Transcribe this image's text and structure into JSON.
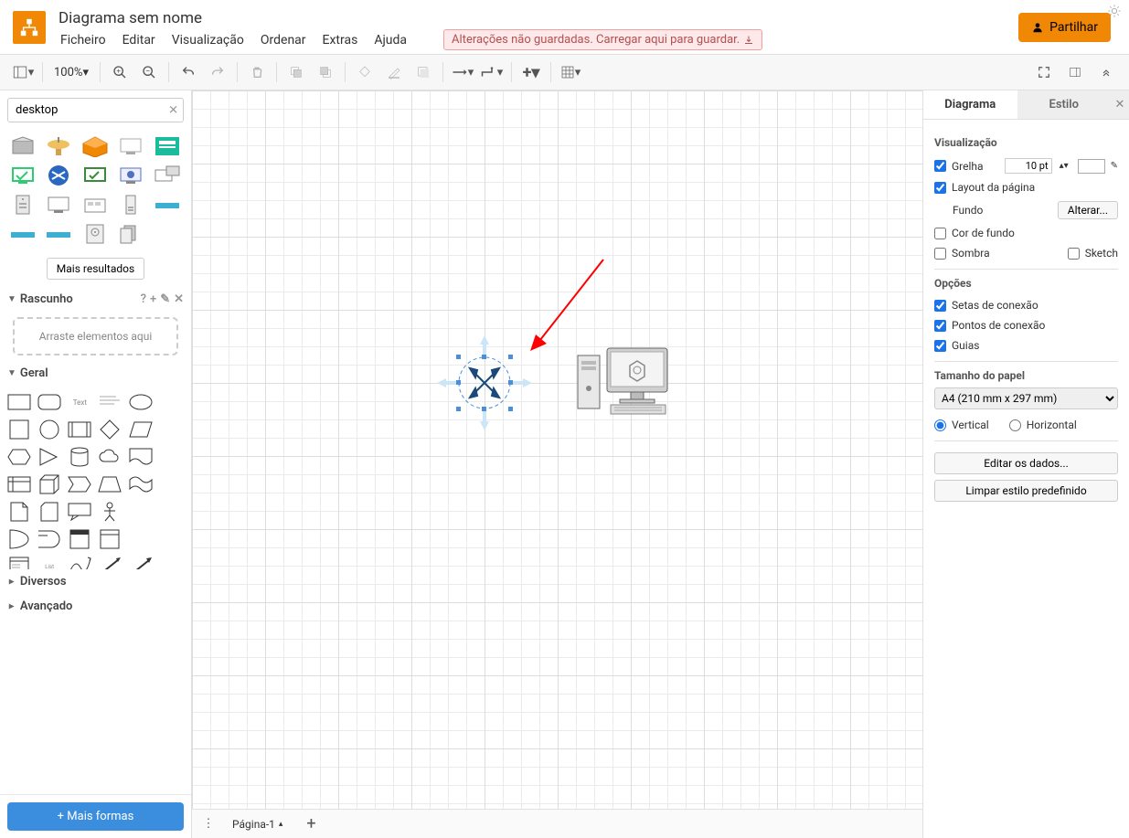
{
  "app": {
    "title": "Diagrama sem nome"
  },
  "menu": {
    "file": "Ficheiro",
    "edit": "Editar",
    "view": "Visualização",
    "arrange": "Ordenar",
    "extras": "Extras",
    "help": "Ajuda"
  },
  "unsaved": "Alterações não guardadas. Carregar aqui para guardar.",
  "share": "Partilhar",
  "zoom": "100%",
  "search": {
    "value": "desktop"
  },
  "more_results": "Mais resultados",
  "scratch": {
    "title": "Rascunho",
    "hint": "Arraste elementos aqui"
  },
  "general": {
    "title": "Geral"
  },
  "misc": {
    "title": "Diversos"
  },
  "advanced": {
    "title": "Avançado"
  },
  "more_shapes": "+ Mais formas",
  "page_tab": "Página-1",
  "tabs": {
    "diagram": "Diagrama",
    "style": "Estilo"
  },
  "panel": {
    "view": "Visualização",
    "grid": "Grelha",
    "grid_pt": "10 pt",
    "page_layout": "Layout da página",
    "background": "Fundo",
    "change": "Alterar...",
    "bg_color": "Cor de fundo",
    "shadow": "Sombra",
    "sketch": "Sketch",
    "options": "Opções",
    "conn_arrows": "Setas de conexão",
    "conn_points": "Pontos de conexão",
    "guides": "Guias",
    "paper_size": "Tamanho do papel",
    "paper_value": "A4 (210 mm x 297 mm)",
    "vertical": "Vertical",
    "horizontal": "Horizontal",
    "edit_data": "Editar os dados...",
    "clear_style": "Limpar estilo predefinido"
  }
}
